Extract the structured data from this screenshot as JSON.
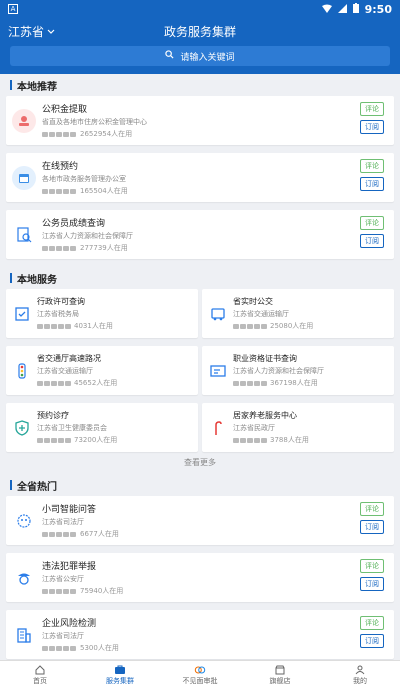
{
  "status_bar": {
    "time": "9:50",
    "app_letter": "A"
  },
  "header": {
    "province": "江苏省",
    "title": "政务服务集群",
    "search_placeholder": "请输入关键词"
  },
  "sections": {
    "local_recommend": "本地推荐",
    "local_services": "本地服务",
    "province_hot": "全省热门"
  },
  "buttons": {
    "comment": "评论",
    "subscribe": "订阅"
  },
  "recommend": [
    {
      "name": "公积金提取",
      "dept": "省直及各地市住房公积金管理中心",
      "usage": "2652954人在用",
      "icon": "fund-icon",
      "color": "#ec6b6b"
    },
    {
      "name": "在线预约",
      "dept": "各地市政务服务管理办公室",
      "usage": "165504人在用",
      "icon": "calendar-icon",
      "color": "#3a8ee6"
    },
    {
      "name": "公务员成绩查询",
      "dept": "江苏省人力资源和社会保障厅",
      "usage": "277739人在用",
      "icon": "document-search-icon",
      "color": "#2b7de9"
    }
  ],
  "local_services": [
    {
      "name": "行政许可查询",
      "dept": "江苏省税务局",
      "usage": "4031人在用",
      "icon": "permit-icon"
    },
    {
      "name": "省实时公交",
      "dept": "江苏省交通运输厅",
      "usage": "25080人在用",
      "icon": "bus-icon"
    },
    {
      "name": "省交通厅高速路况",
      "dept": "江苏省交通运输厅",
      "usage": "45652人在用",
      "icon": "traffic-light-icon"
    },
    {
      "name": "职业资格证书查询",
      "dept": "江苏省人力资源和社会保障厅",
      "usage": "367198人在用",
      "icon": "certificate-icon"
    },
    {
      "name": "预约诊疗",
      "dept": "江苏省卫生健康委员会",
      "usage": "73200人在用",
      "icon": "medical-shield-icon"
    },
    {
      "name": "居家养老服务中心",
      "dept": "江苏省民政厅",
      "usage": "3788人在用",
      "icon": "cane-icon"
    }
  ],
  "see_more": "查看更多",
  "hot": [
    {
      "name": "小司智能问答",
      "dept": "江苏省司法厅",
      "usage": "6677人在用",
      "icon": "robot-icon"
    },
    {
      "name": "违法犯罪举报",
      "dept": "江苏省公安厅",
      "usage": "75940人在用",
      "icon": "police-icon"
    },
    {
      "name": "企业风险检测",
      "dept": "江苏省司法厅",
      "usage": "5300人在用",
      "icon": "building-icon"
    }
  ],
  "tabs": [
    {
      "label": "首页",
      "icon": "home-icon"
    },
    {
      "label": "服务集群",
      "icon": "service-cluster-icon"
    },
    {
      "label": "不见面审批",
      "icon": "approval-icon"
    },
    {
      "label": "旗舰店",
      "icon": "store-icon"
    },
    {
      "label": "我的",
      "icon": "user-icon"
    }
  ],
  "colors": {
    "primary": "#1565c0",
    "comment_green": "#4caf50"
  }
}
